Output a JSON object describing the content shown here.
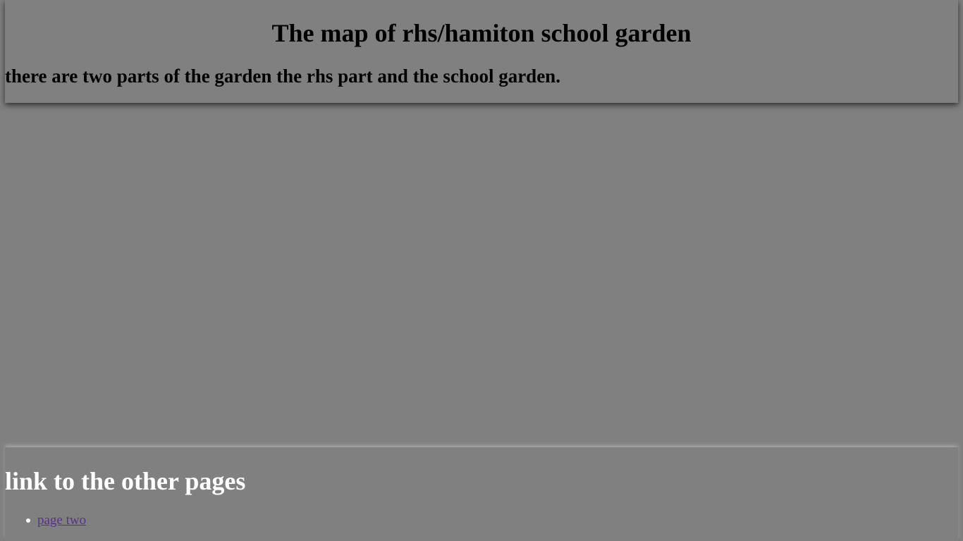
{
  "header": {
    "title": "The map of rhs/hamiton school garden",
    "subtitle": "there are two parts of the garden the rhs part and the school garden."
  },
  "footer": {
    "heading": "link to the other pages",
    "links": [
      {
        "label": "page two"
      }
    ]
  },
  "colors": {
    "background": "#808080",
    "link_visited": "#5b2e8f",
    "footer_heading": "#ffffff"
  }
}
